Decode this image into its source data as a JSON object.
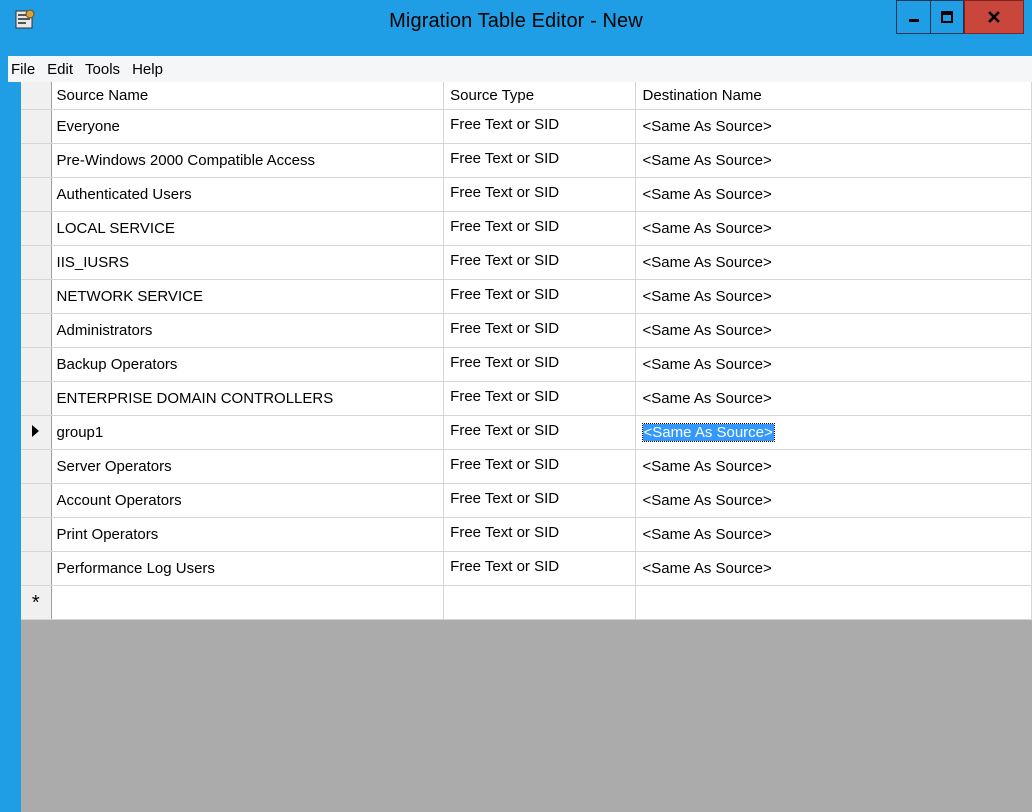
{
  "window": {
    "title": "Migration Table Editor - New"
  },
  "menu": [
    "File",
    "Edit",
    "Tools",
    "Help"
  ],
  "table": {
    "columns": [
      "Source Name",
      "Source Type",
      "Destination Name"
    ],
    "rows": [
      {
        "source_name": "Everyone",
        "source_type": "Free Text or SID",
        "destination_name": "<Same As Source>"
      },
      {
        "source_name": "Pre-Windows 2000 Compatible Access",
        "source_type": "Free Text or SID",
        "destination_name": "<Same As Source>"
      },
      {
        "source_name": "Authenticated Users",
        "source_type": "Free Text or SID",
        "destination_name": "<Same As Source>"
      },
      {
        "source_name": "LOCAL SERVICE",
        "source_type": "Free Text or SID",
        "destination_name": "<Same As Source>"
      },
      {
        "source_name": "IIS_IUSRS",
        "source_type": "Free Text or SID",
        "destination_name": "<Same As Source>"
      },
      {
        "source_name": "NETWORK SERVICE",
        "source_type": "Free Text or SID",
        "destination_name": "<Same As Source>"
      },
      {
        "source_name": "Administrators",
        "source_type": "Free Text or SID",
        "destination_name": "<Same As Source>"
      },
      {
        "source_name": "Backup Operators",
        "source_type": "Free Text or SID",
        "destination_name": "<Same As Source>"
      },
      {
        "source_name": "ENTERPRISE DOMAIN CONTROLLERS",
        "source_type": "Free Text or SID",
        "destination_name": "<Same As Source>"
      },
      {
        "source_name": "group1",
        "source_type": "Free Text or SID",
        "destination_name": "<Same As Source>",
        "current": true
      },
      {
        "source_name": "Server Operators",
        "source_type": "Free Text or SID",
        "destination_name": "<Same As Source>"
      },
      {
        "source_name": "Account Operators",
        "source_type": "Free Text or SID",
        "destination_name": "<Same As Source>"
      },
      {
        "source_name": "Print Operators",
        "source_type": "Free Text or SID",
        "destination_name": "<Same As Source>"
      },
      {
        "source_name": "Performance Log Users",
        "source_type": "Free Text or SID",
        "destination_name": "<Same As Source>"
      }
    ],
    "new_row_marker": "*"
  },
  "colors": {
    "titlebar": "#1f9ee6",
    "close_button": "#c8463b",
    "selection": "#3399ff",
    "empty_grid_area": "#ababab"
  },
  "icons": {
    "app": "migration-table-app-icon",
    "minimize": "minimize-icon",
    "maximize": "maximize-icon",
    "close": "close-icon",
    "current_row": "current-row-arrow-icon"
  }
}
